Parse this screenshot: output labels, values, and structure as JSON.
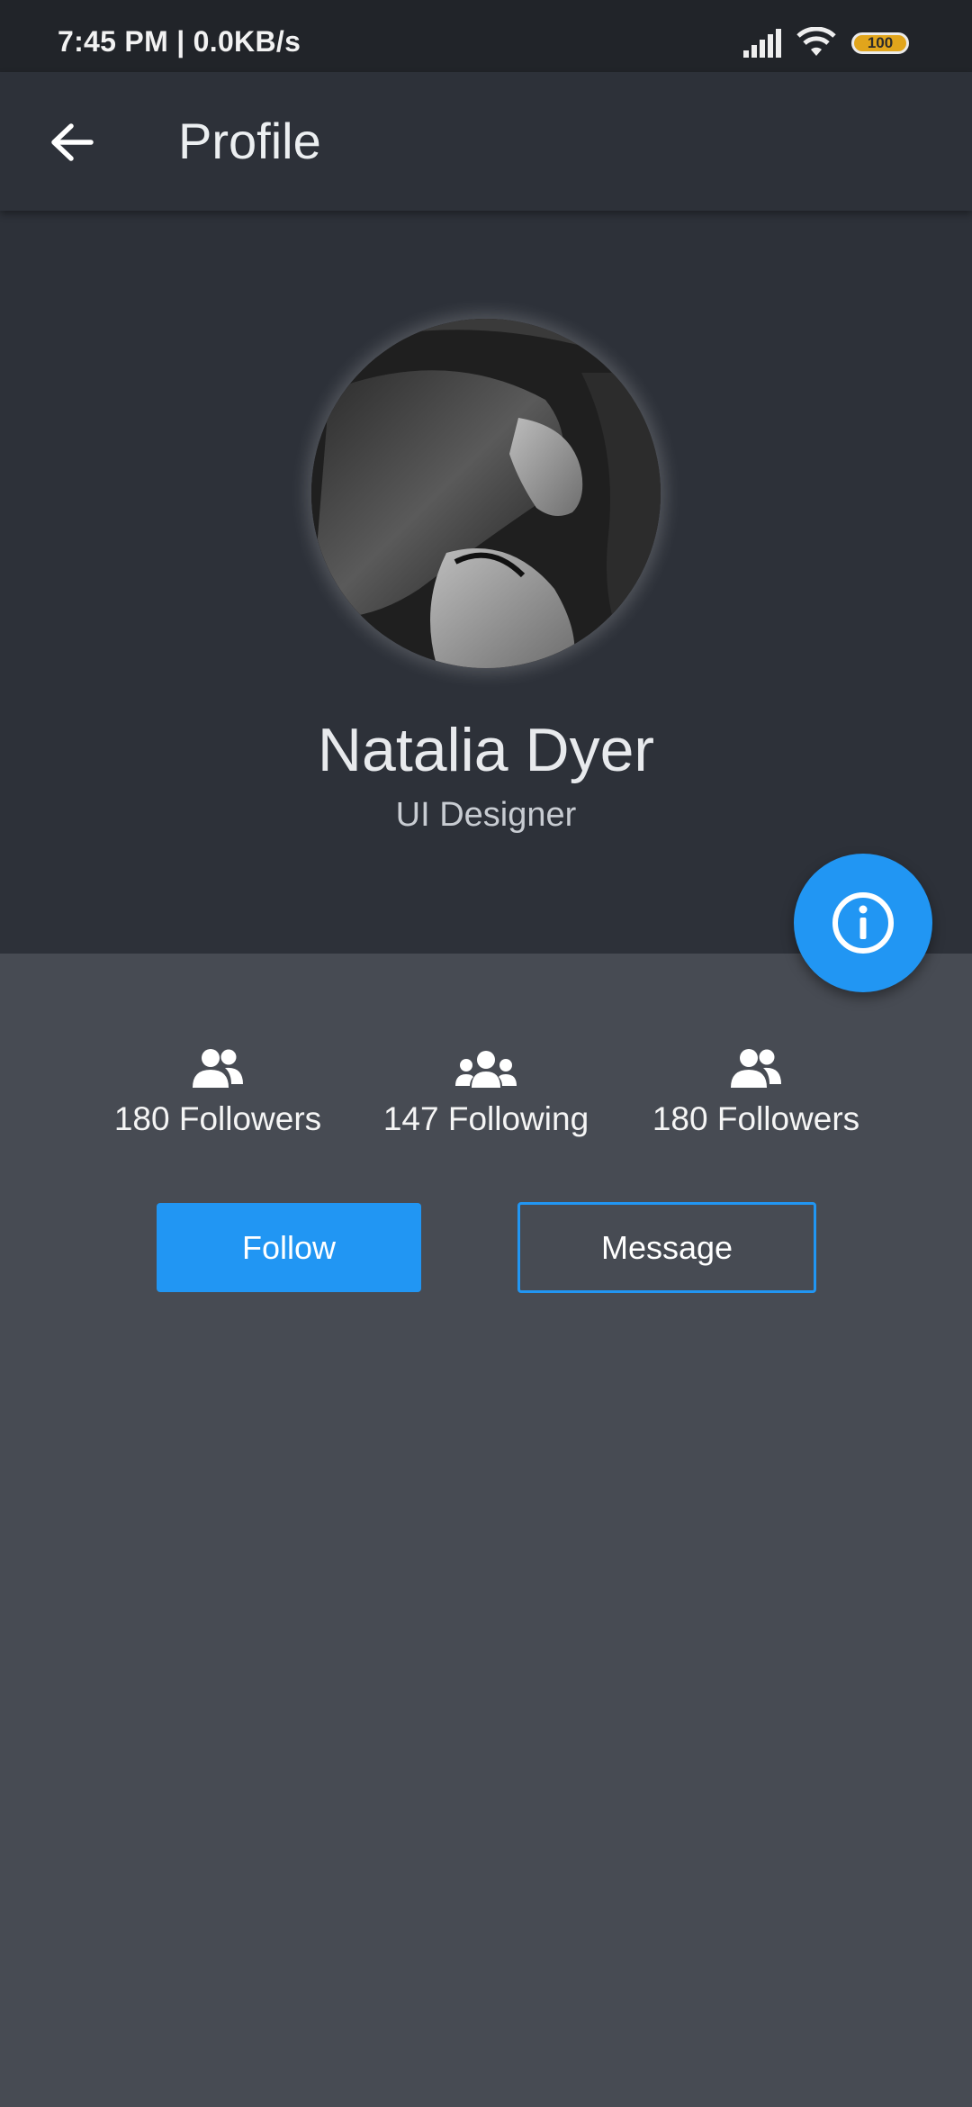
{
  "status_bar": {
    "time": "7:45 PM | 0.0KB/s",
    "battery": "100",
    "icons": [
      "signal-icon",
      "wifi-icon",
      "battery-icon"
    ]
  },
  "app_bar": {
    "title": "Profile",
    "back_icon": "arrow-left-icon"
  },
  "profile": {
    "name": "Natalia Dyer",
    "role": "UI Designer",
    "avatar_icon": "avatar-photo"
  },
  "fab": {
    "icon": "info-icon"
  },
  "stats": [
    {
      "icon": "group-icon",
      "label": "180 Followers"
    },
    {
      "icon": "group-large-icon",
      "label": "147 Following"
    },
    {
      "icon": "group-icon",
      "label": "180 Followers"
    }
  ],
  "actions": {
    "follow_label": "Follow",
    "message_label": "Message"
  },
  "colors": {
    "accent": "#2196f3",
    "header_bg": "#2d3139",
    "body_bg": "#474b53",
    "status_bg": "#212429"
  }
}
